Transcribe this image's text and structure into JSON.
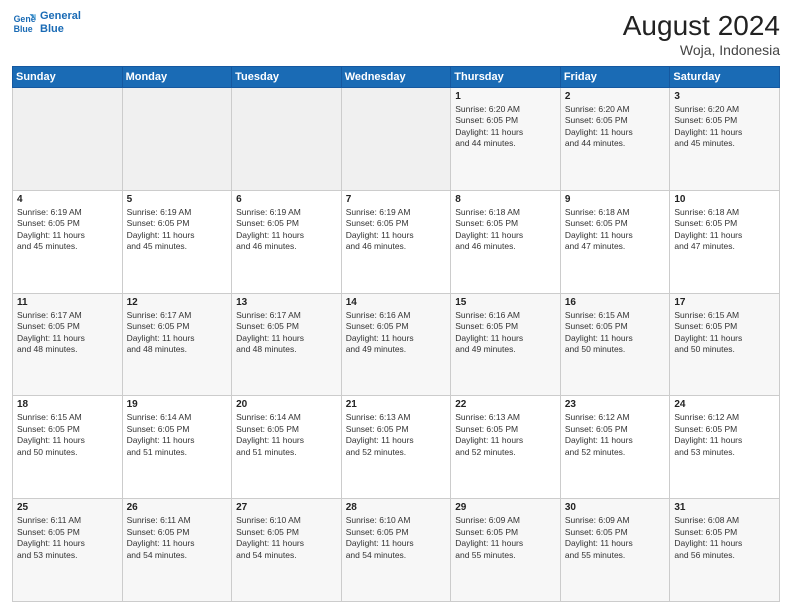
{
  "header": {
    "logo_line1": "General",
    "logo_line2": "Blue",
    "title": "August 2024",
    "subtitle": "Woja, Indonesia"
  },
  "weekdays": [
    "Sunday",
    "Monday",
    "Tuesday",
    "Wednesday",
    "Thursday",
    "Friday",
    "Saturday"
  ],
  "weeks": [
    [
      {
        "day": "",
        "info": ""
      },
      {
        "day": "",
        "info": ""
      },
      {
        "day": "",
        "info": ""
      },
      {
        "day": "",
        "info": ""
      },
      {
        "day": "1",
        "info": "Sunrise: 6:20 AM\nSunset: 6:05 PM\nDaylight: 11 hours\nand 44 minutes."
      },
      {
        "day": "2",
        "info": "Sunrise: 6:20 AM\nSunset: 6:05 PM\nDaylight: 11 hours\nand 44 minutes."
      },
      {
        "day": "3",
        "info": "Sunrise: 6:20 AM\nSunset: 6:05 PM\nDaylight: 11 hours\nand 45 minutes."
      }
    ],
    [
      {
        "day": "4",
        "info": "Sunrise: 6:19 AM\nSunset: 6:05 PM\nDaylight: 11 hours\nand 45 minutes."
      },
      {
        "day": "5",
        "info": "Sunrise: 6:19 AM\nSunset: 6:05 PM\nDaylight: 11 hours\nand 45 minutes."
      },
      {
        "day": "6",
        "info": "Sunrise: 6:19 AM\nSunset: 6:05 PM\nDaylight: 11 hours\nand 46 minutes."
      },
      {
        "day": "7",
        "info": "Sunrise: 6:19 AM\nSunset: 6:05 PM\nDaylight: 11 hours\nand 46 minutes."
      },
      {
        "day": "8",
        "info": "Sunrise: 6:18 AM\nSunset: 6:05 PM\nDaylight: 11 hours\nand 46 minutes."
      },
      {
        "day": "9",
        "info": "Sunrise: 6:18 AM\nSunset: 6:05 PM\nDaylight: 11 hours\nand 47 minutes."
      },
      {
        "day": "10",
        "info": "Sunrise: 6:18 AM\nSunset: 6:05 PM\nDaylight: 11 hours\nand 47 minutes."
      }
    ],
    [
      {
        "day": "11",
        "info": "Sunrise: 6:17 AM\nSunset: 6:05 PM\nDaylight: 11 hours\nand 48 minutes."
      },
      {
        "day": "12",
        "info": "Sunrise: 6:17 AM\nSunset: 6:05 PM\nDaylight: 11 hours\nand 48 minutes."
      },
      {
        "day": "13",
        "info": "Sunrise: 6:17 AM\nSunset: 6:05 PM\nDaylight: 11 hours\nand 48 minutes."
      },
      {
        "day": "14",
        "info": "Sunrise: 6:16 AM\nSunset: 6:05 PM\nDaylight: 11 hours\nand 49 minutes."
      },
      {
        "day": "15",
        "info": "Sunrise: 6:16 AM\nSunset: 6:05 PM\nDaylight: 11 hours\nand 49 minutes."
      },
      {
        "day": "16",
        "info": "Sunrise: 6:15 AM\nSunset: 6:05 PM\nDaylight: 11 hours\nand 50 minutes."
      },
      {
        "day": "17",
        "info": "Sunrise: 6:15 AM\nSunset: 6:05 PM\nDaylight: 11 hours\nand 50 minutes."
      }
    ],
    [
      {
        "day": "18",
        "info": "Sunrise: 6:15 AM\nSunset: 6:05 PM\nDaylight: 11 hours\nand 50 minutes."
      },
      {
        "day": "19",
        "info": "Sunrise: 6:14 AM\nSunset: 6:05 PM\nDaylight: 11 hours\nand 51 minutes."
      },
      {
        "day": "20",
        "info": "Sunrise: 6:14 AM\nSunset: 6:05 PM\nDaylight: 11 hours\nand 51 minutes."
      },
      {
        "day": "21",
        "info": "Sunrise: 6:13 AM\nSunset: 6:05 PM\nDaylight: 11 hours\nand 52 minutes."
      },
      {
        "day": "22",
        "info": "Sunrise: 6:13 AM\nSunset: 6:05 PM\nDaylight: 11 hours\nand 52 minutes."
      },
      {
        "day": "23",
        "info": "Sunrise: 6:12 AM\nSunset: 6:05 PM\nDaylight: 11 hours\nand 52 minutes."
      },
      {
        "day": "24",
        "info": "Sunrise: 6:12 AM\nSunset: 6:05 PM\nDaylight: 11 hours\nand 53 minutes."
      }
    ],
    [
      {
        "day": "25",
        "info": "Sunrise: 6:11 AM\nSunset: 6:05 PM\nDaylight: 11 hours\nand 53 minutes."
      },
      {
        "day": "26",
        "info": "Sunrise: 6:11 AM\nSunset: 6:05 PM\nDaylight: 11 hours\nand 54 minutes."
      },
      {
        "day": "27",
        "info": "Sunrise: 6:10 AM\nSunset: 6:05 PM\nDaylight: 11 hours\nand 54 minutes."
      },
      {
        "day": "28",
        "info": "Sunrise: 6:10 AM\nSunset: 6:05 PM\nDaylight: 11 hours\nand 54 minutes."
      },
      {
        "day": "29",
        "info": "Sunrise: 6:09 AM\nSunset: 6:05 PM\nDaylight: 11 hours\nand 55 minutes."
      },
      {
        "day": "30",
        "info": "Sunrise: 6:09 AM\nSunset: 6:05 PM\nDaylight: 11 hours\nand 55 minutes."
      },
      {
        "day": "31",
        "info": "Sunrise: 6:08 AM\nSunset: 6:05 PM\nDaylight: 11 hours\nand 56 minutes."
      }
    ]
  ]
}
